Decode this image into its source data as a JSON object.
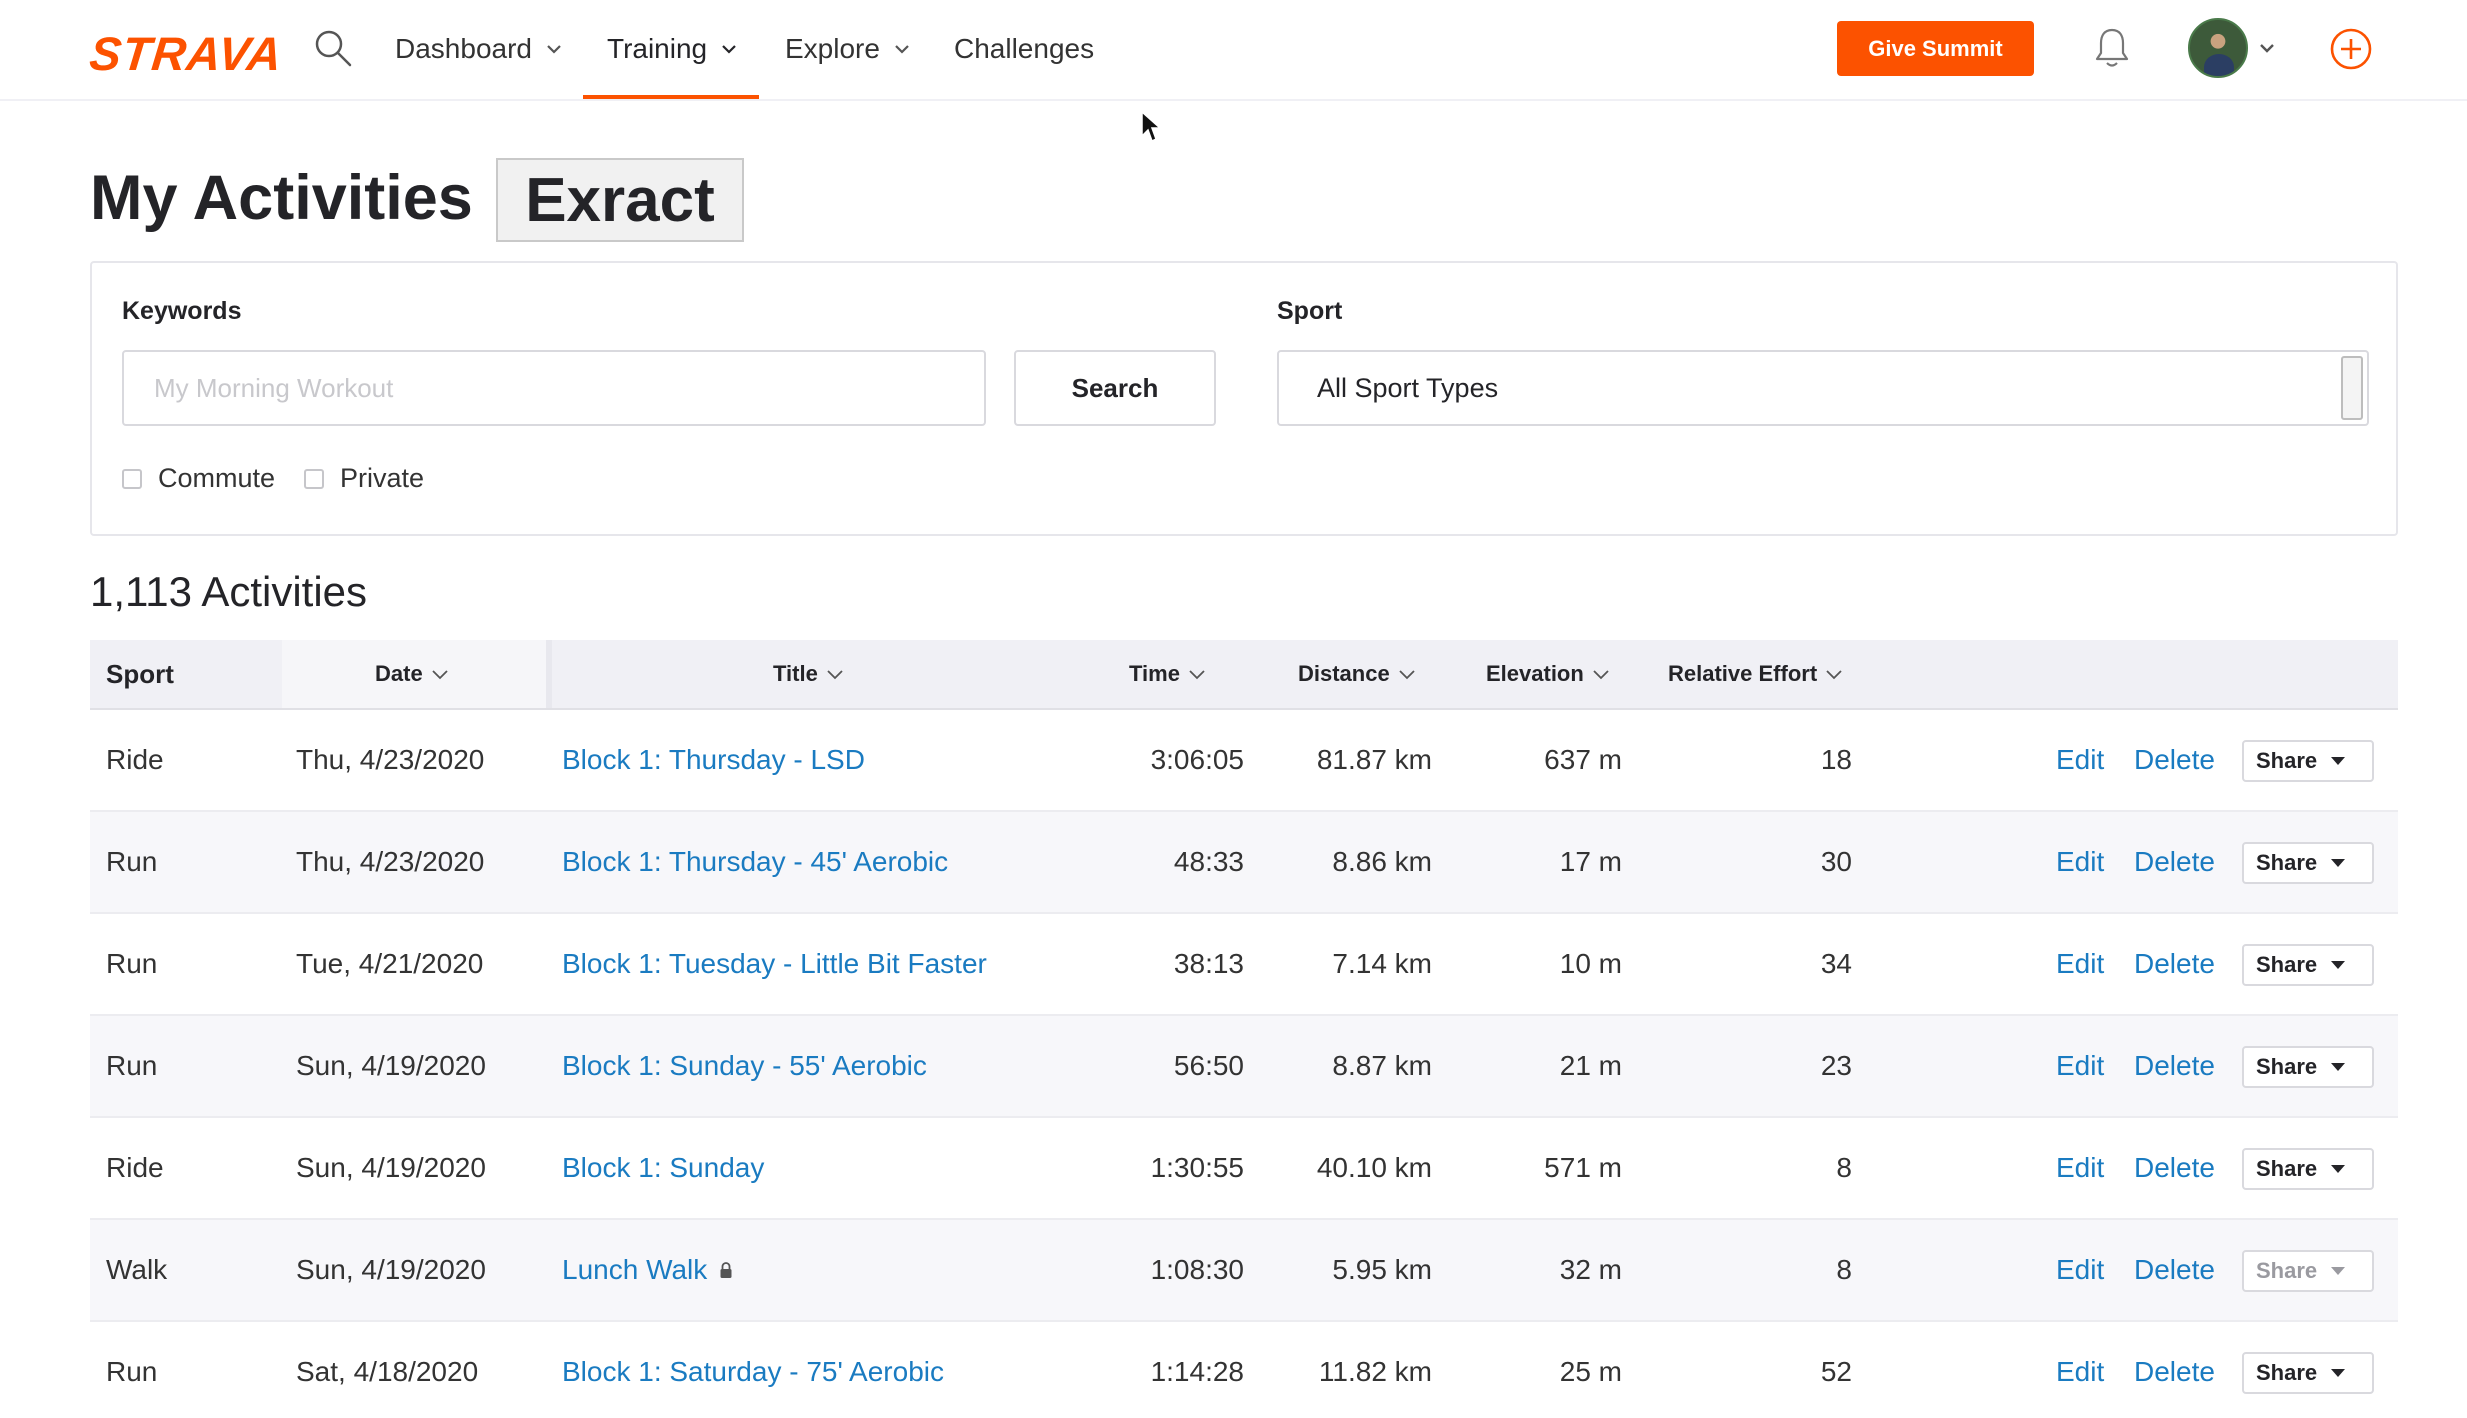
{
  "nav": {
    "logo": "STRAVA",
    "items": [
      {
        "label": "Dashboard",
        "dropdown": true
      },
      {
        "label": "Training",
        "dropdown": true,
        "active": true
      },
      {
        "label": "Explore",
        "dropdown": true
      },
      {
        "label": "Challenges",
        "dropdown": false
      }
    ],
    "cta_label": "Give Summit",
    "accent": "#fc5200"
  },
  "heading": {
    "title": "My Activities",
    "overlay_text": "Exract"
  },
  "filters": {
    "keywords_label": "Keywords",
    "keywords_placeholder": "My Morning Workout",
    "search_label": "Search",
    "sport_label": "Sport",
    "sport_value": "All Sport Types",
    "commute_label": "Commute",
    "private_label": "Private"
  },
  "summary": {
    "count_text": "1,113 Activities"
  },
  "table": {
    "columns": {
      "sport": "Sport",
      "date": "Date",
      "title": "Title",
      "time": "Time",
      "distance": "Distance",
      "elevation": "Elevation",
      "effort": "Relative Effort"
    },
    "action_labels": {
      "edit": "Edit",
      "delete": "Delete",
      "share": "Share"
    },
    "rows": [
      {
        "sport": "Ride",
        "date": "Thu, 4/23/2020",
        "title": "Block 1: Thursday - LSD",
        "time": "3:06:05",
        "distance": "81.87 km",
        "elevation": "637 m",
        "effort": "18",
        "private": false
      },
      {
        "sport": "Run",
        "date": "Thu, 4/23/2020",
        "title": "Block 1: Thursday - 45' Aerobic",
        "time": "48:33",
        "distance": "8.86 km",
        "elevation": "17 m",
        "effort": "30",
        "private": false
      },
      {
        "sport": "Run",
        "date": "Tue, 4/21/2020",
        "title": "Block 1: Tuesday - Little Bit Faster",
        "time": "38:13",
        "distance": "7.14 km",
        "elevation": "10 m",
        "effort": "34",
        "private": false
      },
      {
        "sport": "Run",
        "date": "Sun, 4/19/2020",
        "title": "Block 1: Sunday - 55' Aerobic",
        "time": "56:50",
        "distance": "8.87 km",
        "elevation": "21 m",
        "effort": "23",
        "private": false
      },
      {
        "sport": "Ride",
        "date": "Sun, 4/19/2020",
        "title": "Block 1: Sunday",
        "time": "1:30:55",
        "distance": "40.10 km",
        "elevation": "571 m",
        "effort": "8",
        "private": false
      },
      {
        "sport": "Walk",
        "date": "Sun, 4/19/2020",
        "title": "Lunch Walk",
        "time": "1:08:30",
        "distance": "5.95 km",
        "elevation": "32 m",
        "effort": "8",
        "private": true
      },
      {
        "sport": "Run",
        "date": "Sat, 4/18/2020",
        "title": "Block 1: Saturday - 75' Aerobic",
        "time": "1:14:28",
        "distance": "11.82 km",
        "elevation": "25 m",
        "effort": "52",
        "private": false
      }
    ]
  },
  "colors": {
    "link": "#1a7bc1",
    "header_bg": "#f0f0f5",
    "alt_row_bg": "#f7f7fa"
  },
  "icons": [
    "search-icon",
    "chevron-down-icon",
    "bell-icon",
    "avatar",
    "add-circle-icon",
    "sort-chevron-icon",
    "lock-icon",
    "caret-down-icon",
    "cursor-icon"
  ]
}
